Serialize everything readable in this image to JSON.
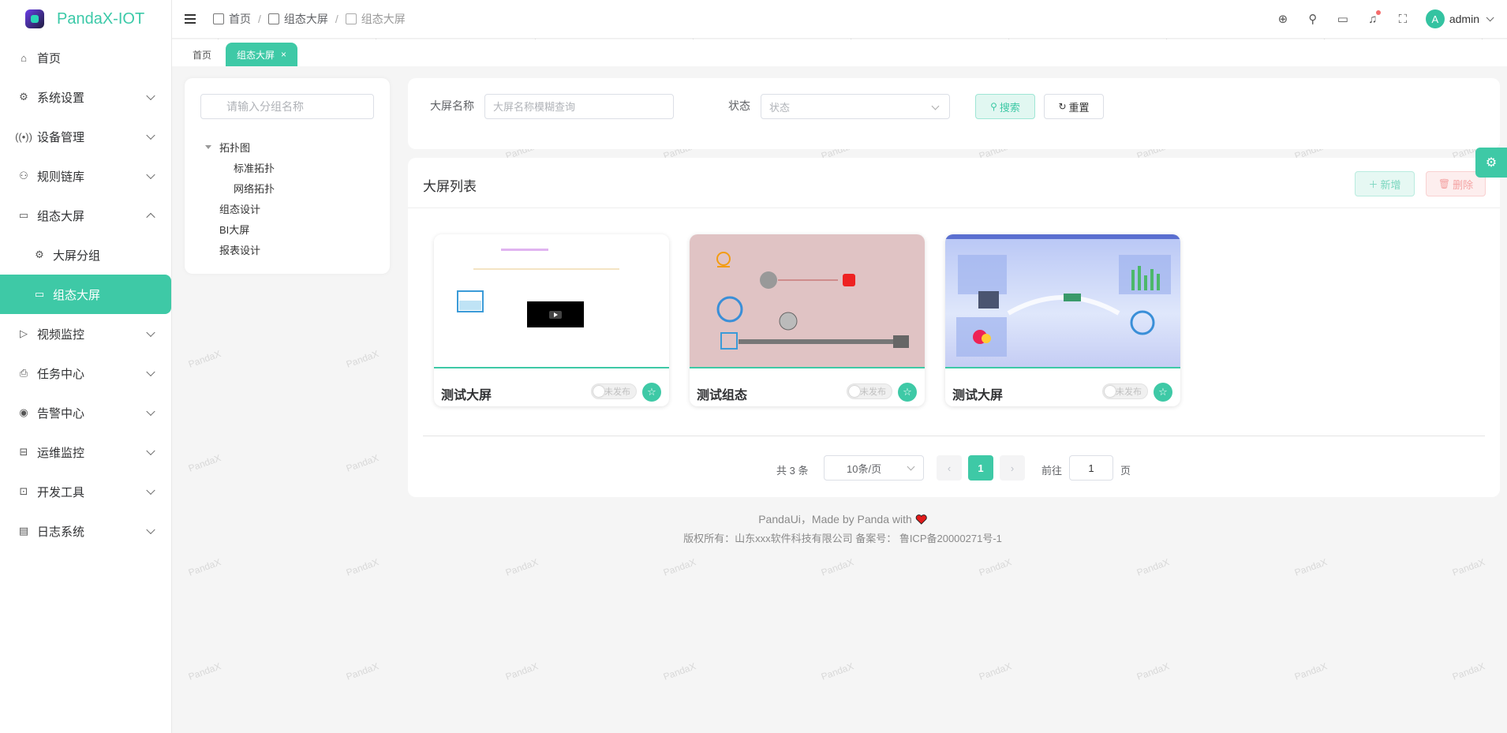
{
  "app": {
    "name": "PandaX-IOT"
  },
  "sidebar": {
    "items": [
      {
        "label": "首页",
        "icon": "home-icon",
        "has_children": false
      },
      {
        "label": "系统设置",
        "icon": "gear-icon",
        "has_children": true
      },
      {
        "label": "设备管理",
        "icon": "broadcast-icon",
        "has_children": true
      },
      {
        "label": "规则链库",
        "icon": "flow-icon",
        "has_children": true
      },
      {
        "label": "组态大屏",
        "icon": "monitor-icon",
        "has_children": true,
        "expanded": true
      },
      {
        "label": "大屏分组",
        "icon": "gear-icon",
        "sub": true
      },
      {
        "label": "组态大屏",
        "icon": "monitor-icon",
        "sub": true,
        "active": true
      },
      {
        "label": "视频监控",
        "icon": "play-icon",
        "has_children": true
      },
      {
        "label": "任务中心",
        "icon": "printer-icon",
        "has_children": true
      },
      {
        "label": "告警中心",
        "icon": "alarm-icon",
        "has_children": true
      },
      {
        "label": "运维监控",
        "icon": "briefcase-icon",
        "has_children": true
      },
      {
        "label": "开发工具",
        "icon": "code-icon",
        "has_children": true
      },
      {
        "label": "日志系统",
        "icon": "document-icon",
        "has_children": true
      }
    ]
  },
  "header": {
    "breadcrumb": [
      "首页",
      "组态大屏",
      "组态大屏"
    ],
    "user": {
      "initial": "A",
      "name": "admin"
    },
    "icons": [
      "language-icon",
      "search-icon",
      "monitor-icon",
      "bell-icon",
      "fullscreen-icon"
    ]
  },
  "tabs": [
    {
      "label": "首页",
      "active": false
    },
    {
      "label": "组态大屏",
      "active": true,
      "close": "×"
    }
  ],
  "tree": {
    "placeholder": "请输入分组名称",
    "nodes": [
      {
        "label": "拓扑图",
        "children": [
          "标准拓扑",
          "网络拓扑"
        ]
      },
      {
        "label": "组态设计"
      },
      {
        "label": "BI大屏"
      },
      {
        "label": "报表设计"
      }
    ]
  },
  "search": {
    "name_label": "大屏名称",
    "name_placeholder": "大屏名称模糊查询",
    "status_label": "状态",
    "status_placeholder": "状态",
    "search_button": "搜索",
    "reset_button": "重置"
  },
  "list": {
    "title": "大屏列表",
    "add_button": "新增",
    "delete_button": "删除",
    "cards": [
      {
        "title": "测试大屏",
        "status": "未发布"
      },
      {
        "title": "测试组态",
        "status": "未发布"
      },
      {
        "title": "测试大屏",
        "status": "未发布"
      }
    ]
  },
  "pagination": {
    "total": "共 3 条",
    "page_size": "10条/页",
    "current": "1",
    "goto_label": "前往",
    "goto_value": "1",
    "page_suffix": "页"
  },
  "footer": {
    "line1": "PandaUi，Made by Panda with",
    "line2": "版权所有：山东xxx软件科技有限公司 备案号： 鲁ICP备20000271号-1"
  },
  "watermark": "PandaX",
  "colors": {
    "primary": "#3ec9a6",
    "danger": "#f56c6c",
    "brand_text": "#3bc9a8"
  }
}
